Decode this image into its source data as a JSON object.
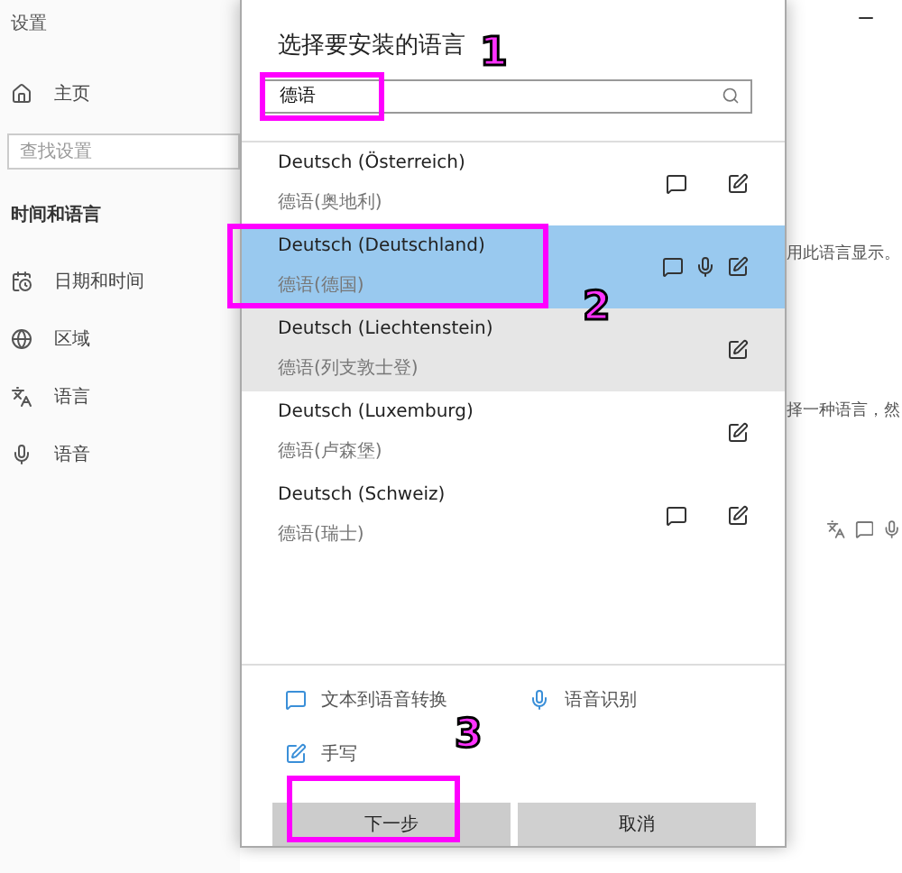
{
  "settings": {
    "title": "设置",
    "home": "主页",
    "search_placeholder": "查找设置",
    "section": "时间和语言",
    "nav": [
      {
        "label": "日期和时间",
        "kind": "date"
      },
      {
        "label": "区域",
        "kind": "region"
      },
      {
        "label": "语言",
        "kind": "language"
      },
      {
        "label": "语音",
        "kind": "speech"
      }
    ],
    "background_texts": [
      "用此语言显示。",
      "择一种语言，然"
    ]
  },
  "dialog": {
    "title": "选择要安装的语言",
    "search": {
      "value": "德语"
    },
    "languages": [
      {
        "name": "Deutsch (Österreich)",
        "native": "德语(奥地利)",
        "tts": true,
        "speech": false,
        "handwriting": true,
        "selected": false,
        "highlighted": false
      },
      {
        "name": "Deutsch (Deutschland)",
        "native": "德语(德国)",
        "tts": true,
        "speech": true,
        "handwriting": true,
        "selected": true,
        "highlighted": false
      },
      {
        "name": "Deutsch (Liechtenstein)",
        "native": "德语(列支敦士登)",
        "tts": false,
        "speech": false,
        "handwriting": true,
        "selected": false,
        "highlighted": true
      },
      {
        "name": "Deutsch (Luxemburg)",
        "native": "德语(卢森堡)",
        "tts": false,
        "speech": false,
        "handwriting": true,
        "selected": false,
        "highlighted": false
      },
      {
        "name": "Deutsch (Schweiz)",
        "native": "德语(瑞士)",
        "tts": true,
        "speech": false,
        "handwriting": true,
        "selected": false,
        "highlighted": false
      }
    ],
    "legend": [
      {
        "kind": "tts",
        "label": "文本到语音转换"
      },
      {
        "kind": "speech",
        "label": "语音识别"
      },
      {
        "kind": "handwriting",
        "label": "手写"
      }
    ],
    "buttons": [
      "下一步",
      "取消"
    ]
  },
  "annotations": [
    {
      "label": "1"
    },
    {
      "label": "2"
    },
    {
      "label": "3"
    }
  ]
}
